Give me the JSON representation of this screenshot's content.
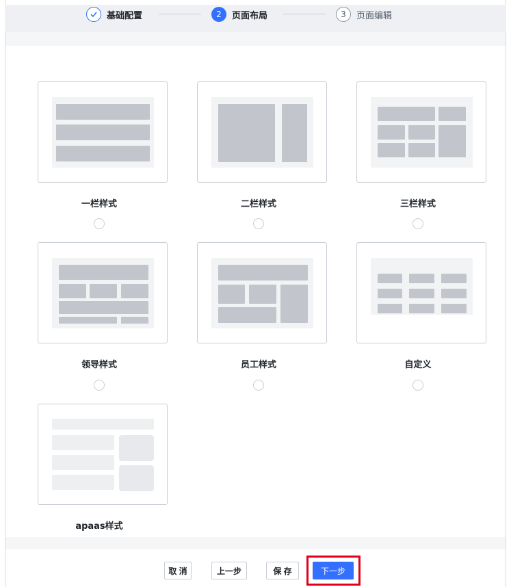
{
  "steps": [
    {
      "index": "✓",
      "label": "基础配置",
      "state": "done"
    },
    {
      "index": "2",
      "label": "页面布局",
      "state": "active"
    },
    {
      "index": "3",
      "label": "页面编辑",
      "state": "todo"
    }
  ],
  "layouts": [
    {
      "name": "一栏样式"
    },
    {
      "name": "二栏样式"
    },
    {
      "name": "三栏样式"
    },
    {
      "name": "领导样式"
    },
    {
      "name": "员工样式"
    },
    {
      "name": "自定义"
    },
    {
      "name": "apaas样式"
    }
  ],
  "footer": {
    "cancel_label": "取 消",
    "prev_label": "上一步",
    "save_label": "保 存",
    "next_label": "下一步"
  },
  "colors": {
    "accent": "#3370ff",
    "highlight_box": "#e0001b"
  }
}
